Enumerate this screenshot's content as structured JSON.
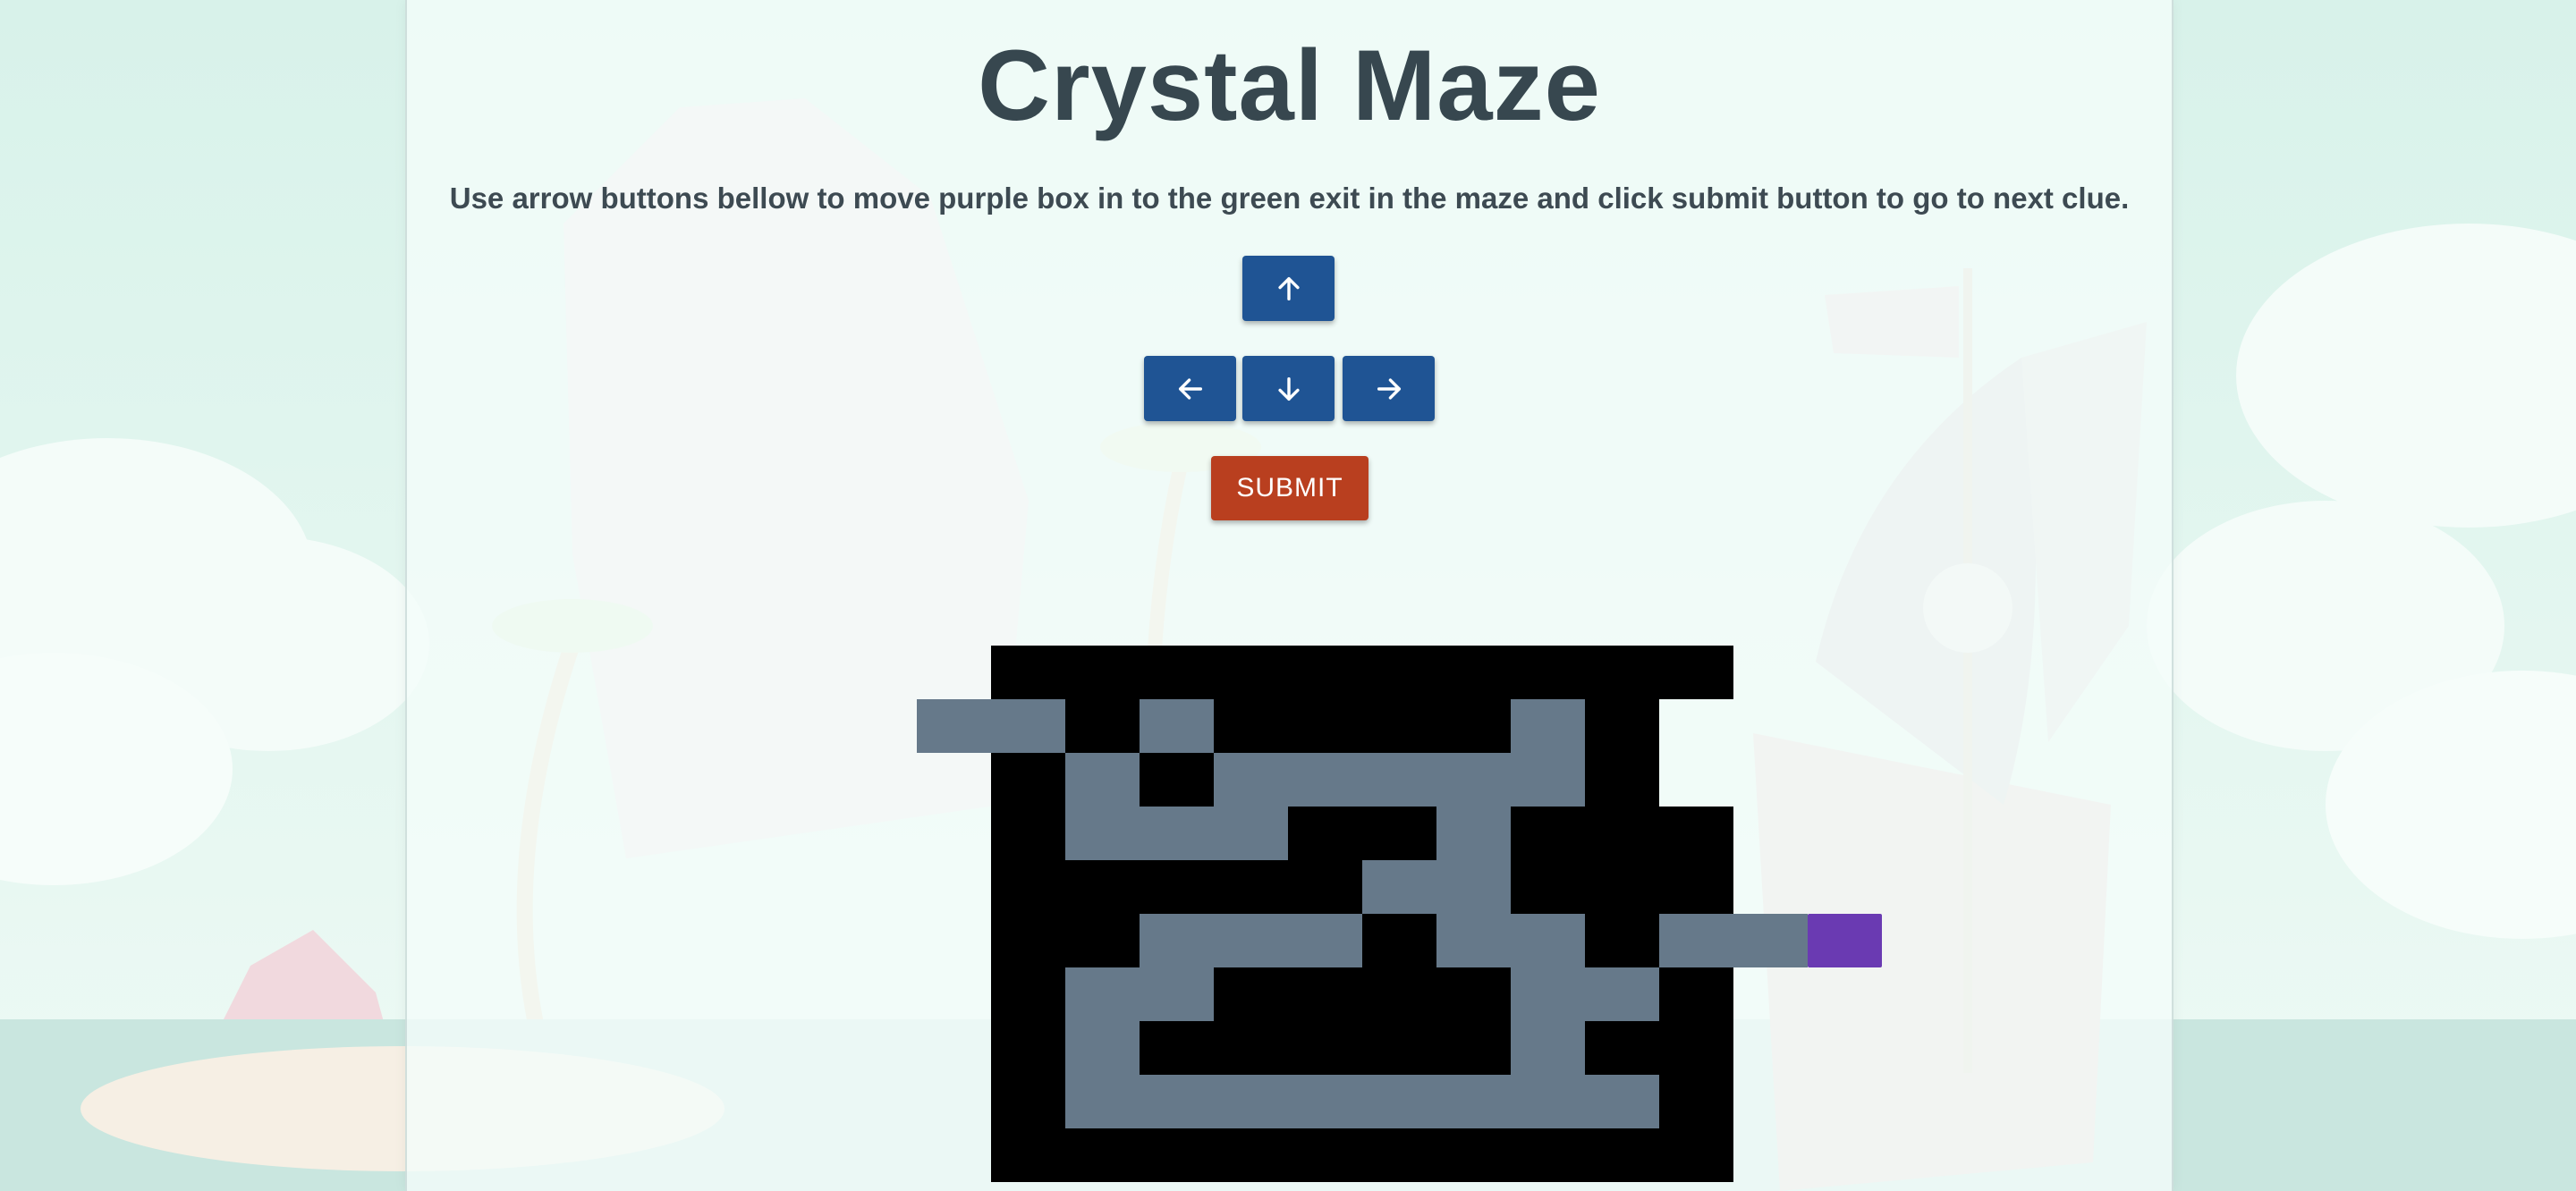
{
  "header": {
    "title": "Crystal Maze",
    "instructions": "Use arrow buttons bellow to move purple box in to the green exit in the maze and click submit button to go to next clue."
  },
  "controls": {
    "up": "arrow-up-icon",
    "left": "arrow-left-icon",
    "down": "arrow-down-icon",
    "right": "arrow-right-icon",
    "submit_label": "SUBMIT"
  },
  "colors": {
    "arrow_button": "#1f5494",
    "submit_button": "#b93f1f",
    "wall": "#000000",
    "path": "#66798a",
    "player": "#6a3ab2",
    "title_text": "#37474f"
  },
  "maze": {
    "legend": {
      "#": "wall",
      ".": "path",
      "P": "player",
      " ": "outside"
    },
    "grid": [
      " ########## ",
      "..#.####.#  ",
      " #.#.....#  ",
      " #...##.###  ",
      " #####..###  ",
      " ##...#..#..P",
      " #..####..# ",
      " #.#####.## ",
      " #........# ",
      " ########## "
    ]
  }
}
